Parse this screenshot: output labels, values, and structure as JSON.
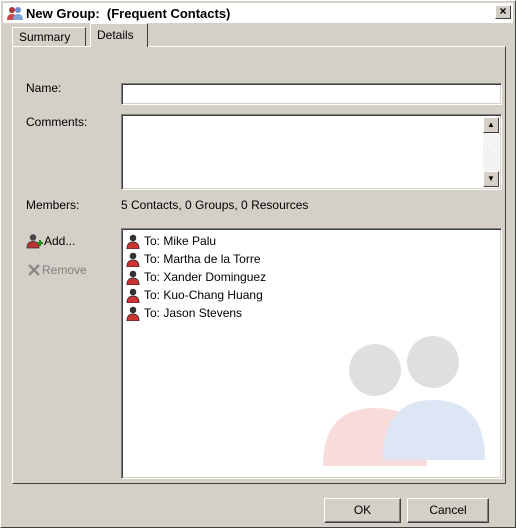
{
  "window": {
    "title": "New Group:  (Frequent Contacts)",
    "close_label": "×"
  },
  "tabs": [
    {
      "label": "Summary",
      "active": false
    },
    {
      "label": "Details",
      "active": true
    }
  ],
  "form": {
    "name_label": "Name:",
    "name_value": "",
    "comments_label": "Comments:",
    "comments_value": "",
    "members_label": "Members:",
    "members_summary": "5 Contacts, 0 Groups, 0 Resources"
  },
  "actions": {
    "add_label": "Add...",
    "remove_label": "Remove"
  },
  "members": [
    {
      "label": "To: Mike Palu"
    },
    {
      "label": "To: Martha de la Torre"
    },
    {
      "label": "To: Xander Dominguez"
    },
    {
      "label": "To: Kuo-Chang Huang"
    },
    {
      "label": "To: Jason Stevens"
    }
  ],
  "buttons": {
    "ok_label": "OK",
    "cancel_label": "Cancel"
  },
  "icons": {
    "title": "group-icon",
    "member": "person-icon",
    "add": "add-person-icon",
    "remove": "remove-x-icon",
    "watermark": "group-watermark-icon"
  }
}
